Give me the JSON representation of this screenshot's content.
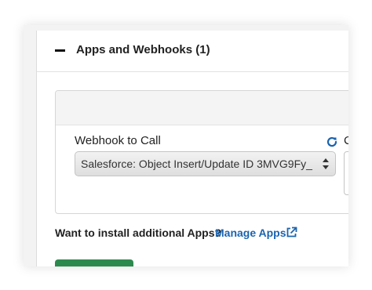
{
  "section": {
    "title": "Apps and Webhooks (1)",
    "collapse_icon": "minus-icon"
  },
  "webhook": {
    "label": "Webhook to Call",
    "selected_value": "Salesforce: Object Insert/Update ID 3MVG9Fy_",
    "refresh_icon": "refresh-icon",
    "next_field_label": "C"
  },
  "footer": {
    "install_prompt": "Want to install additional Apps?",
    "manage_link": "Manage Apps",
    "external_icon": "external-link-icon"
  },
  "colors": {
    "link": "#1a64b0",
    "button": "#2d8a4e",
    "refresh": "#1a64b0"
  }
}
